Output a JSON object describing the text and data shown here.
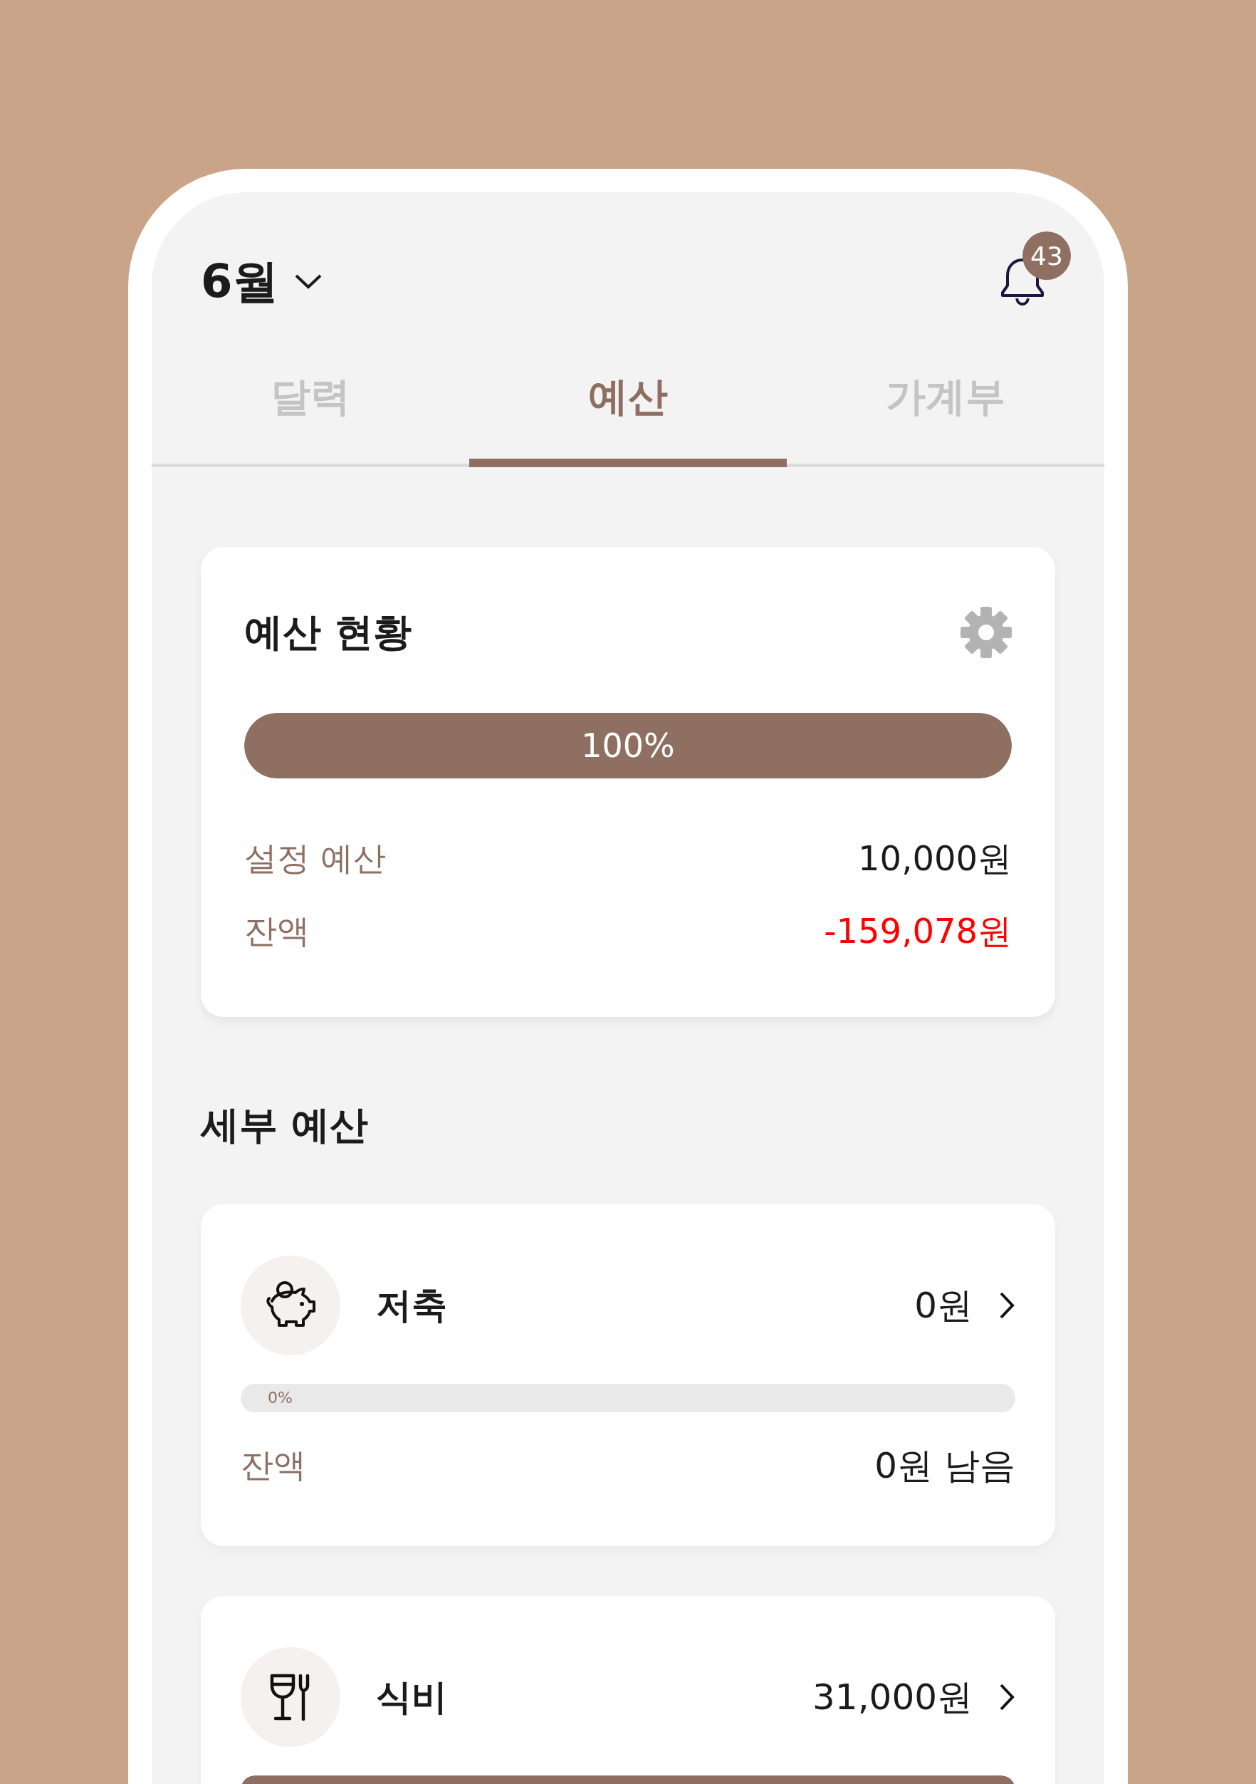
{
  "header": {
    "month": "6월",
    "notification_count": "43"
  },
  "tabs": [
    {
      "label": "달력",
      "selected": false
    },
    {
      "label": "예산",
      "selected": true
    },
    {
      "label": "가계부",
      "selected": false
    }
  ],
  "summary": {
    "title": "예산 현황",
    "progress": {
      "level": 1,
      "label": "100%"
    },
    "rows": [
      {
        "label": "설정 예산",
        "value": "10,000원",
        "negative": false
      },
      {
        "label": "잔액",
        "value": "-159,078원",
        "negative": true
      }
    ]
  },
  "section_title": "세부 예산",
  "categories": [
    {
      "kind": "savings",
      "name": "저축",
      "amount": "0원",
      "level": 0,
      "percent": "0%",
      "remaining_label": "잔액",
      "remaining": "0원 남음"
    },
    {
      "kind": "food",
      "name": "식비",
      "amount": "31,000원",
      "level": 1
    }
  ]
}
